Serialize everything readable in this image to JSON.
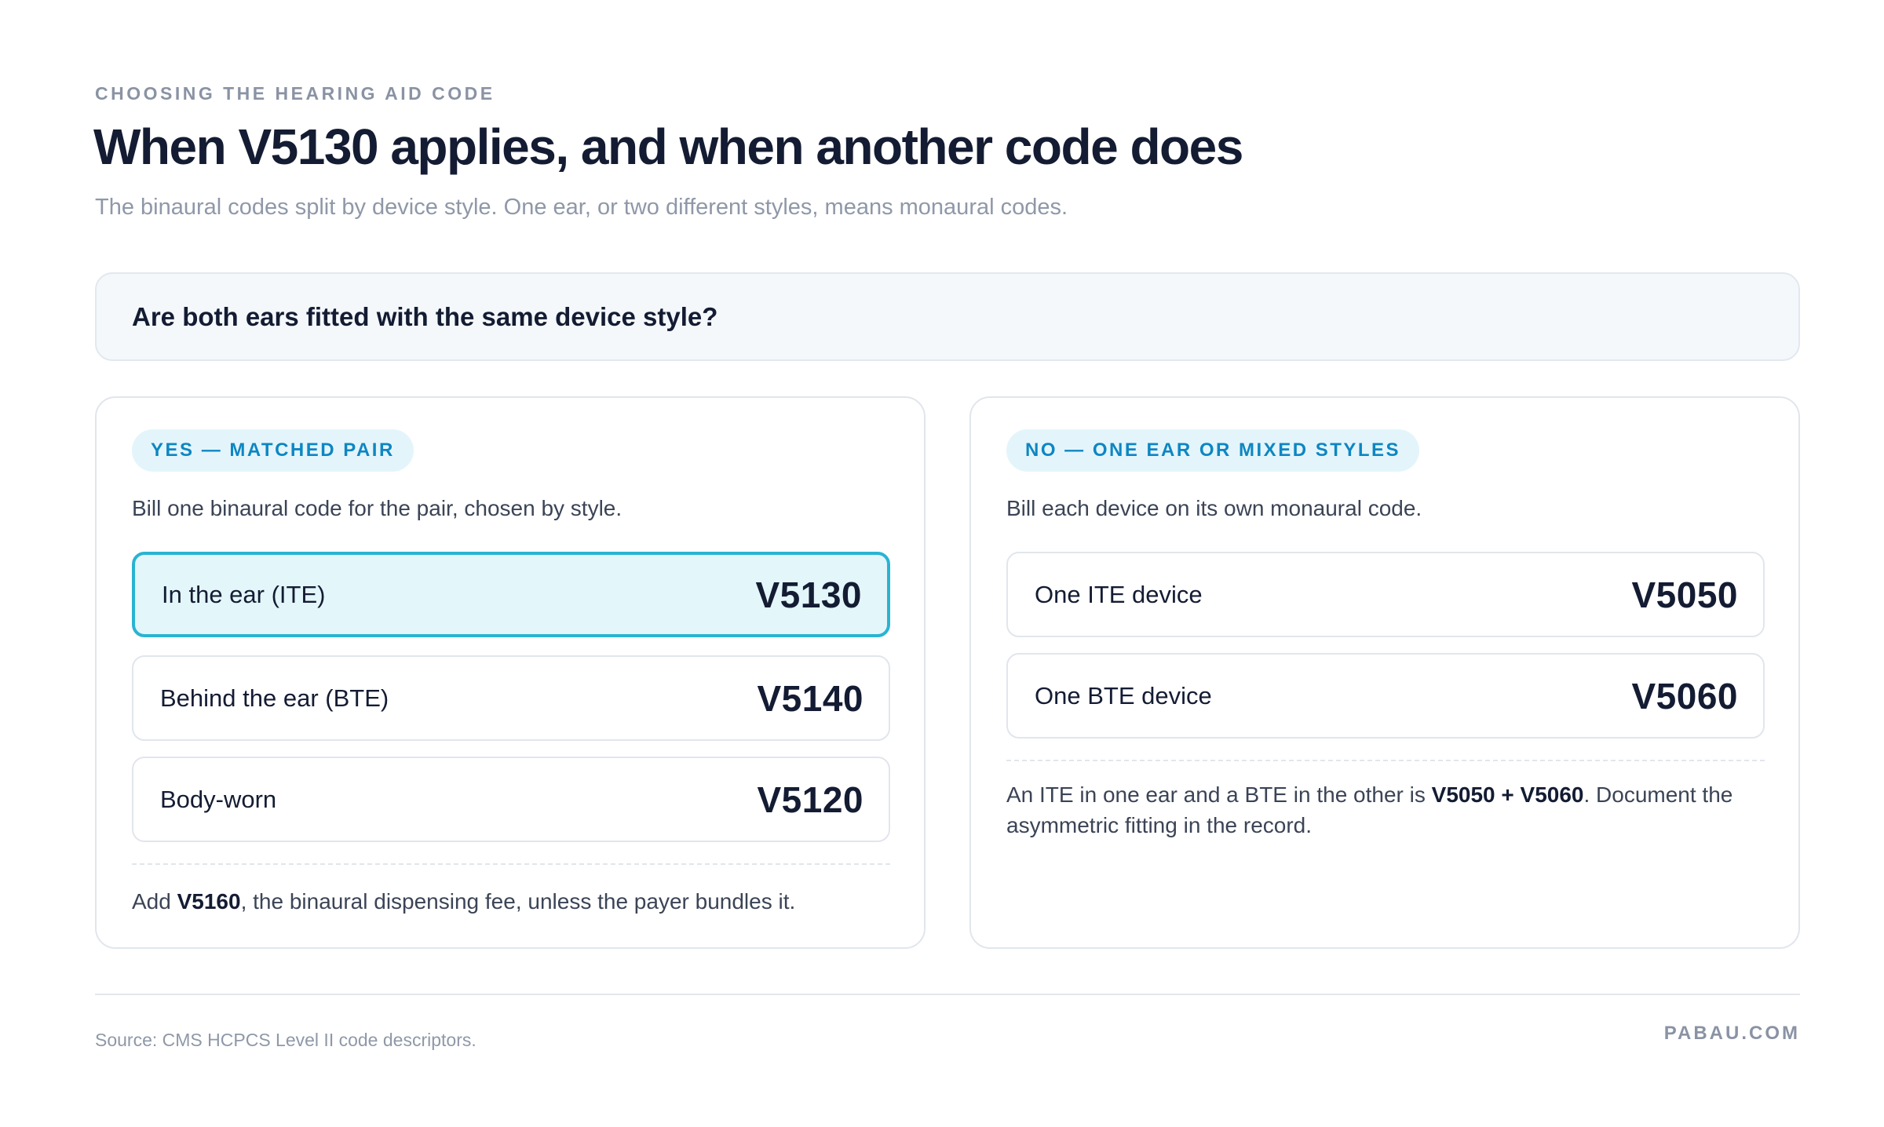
{
  "header": {
    "eyebrow": "CHOOSING THE HEARING AID CODE",
    "title": "When V5130 applies, and when another code does",
    "subtitle": "The binaural codes split by device style. One ear, or two different styles, means monaural codes."
  },
  "question": "Are both ears fitted with the same device style?",
  "yes_panel": {
    "pill": "YES — MATCHED PAIR",
    "description": "Bill one binaural code for the pair, chosen by style.",
    "rows": [
      {
        "label": "In the ear (ITE)",
        "code": "V5130",
        "highlighted": true
      },
      {
        "label": "Behind the ear (BTE)",
        "code": "V5140",
        "highlighted": false
      },
      {
        "label": "Body-worn",
        "code": "V5120",
        "highlighted": false
      }
    ],
    "note": {
      "prefix": "Add ",
      "code": "V5160",
      "suffix": ", the binaural dispensing fee, unless the payer bundles it."
    }
  },
  "no_panel": {
    "pill": "NO — ONE EAR OR MIXED STYLES",
    "description": "Bill each device on its own monaural code.",
    "rows": [
      {
        "label": "One ITE device",
        "code": "V5050"
      },
      {
        "label": "One BTE device",
        "code": "V5060"
      }
    ],
    "note": {
      "prefix": "An ITE in one ear and a BTE in the other is ",
      "code": "V5050 + V5060",
      "suffix": ". Document the asymmetric fitting in the record."
    }
  },
  "footer": {
    "source": "Source: CMS HCPCS Level II code descriptors.",
    "brand": "PABAU.COM"
  },
  "colors": {
    "accent": "#0e86c2",
    "highlight_border": "#2ab3d2",
    "highlight_fill": "#e3f6fa",
    "ink": "#141c33",
    "muted": "#8f98a8"
  }
}
